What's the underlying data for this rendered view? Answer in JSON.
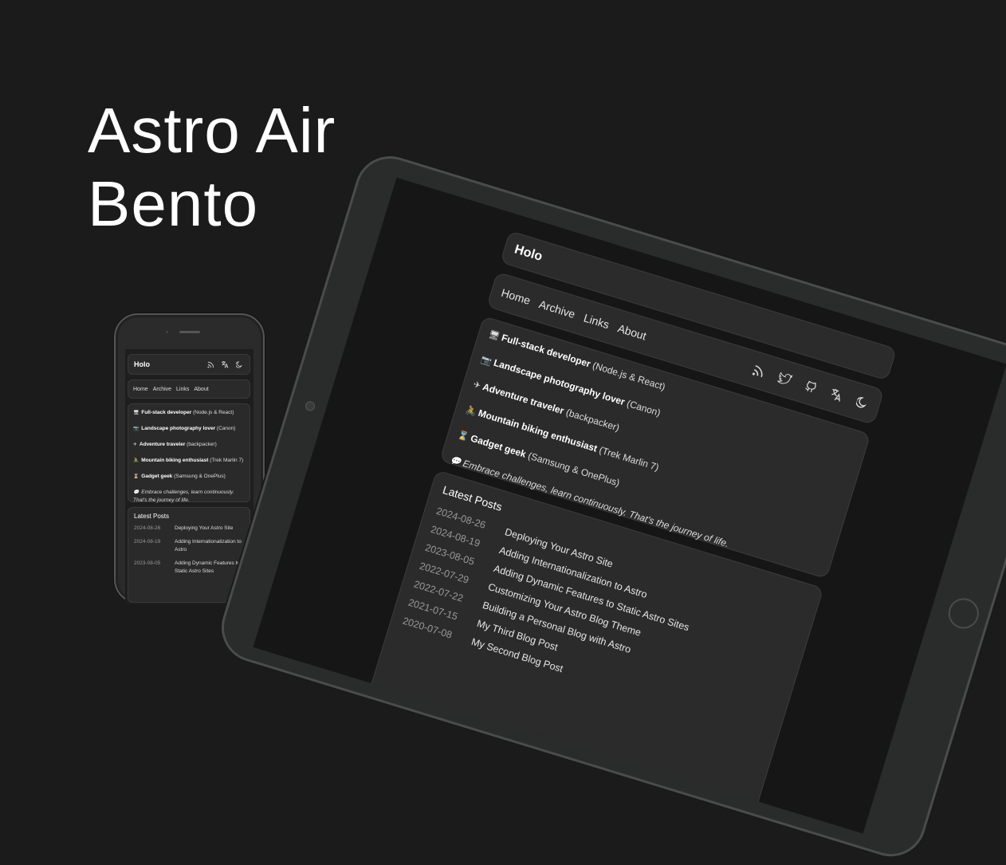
{
  "hero": {
    "line1": "Astro Air",
    "line2": "Bento"
  },
  "site": {
    "logo": "Holo",
    "nav": [
      "Home",
      "Archive",
      "Links",
      "About"
    ],
    "intro": [
      {
        "emoji": "🖥",
        "bold": "Full-stack developer",
        "rest": " (Node.js & React)"
      },
      {
        "emoji": "📷",
        "bold": "Landscape photography lover",
        "rest": " (Canon)"
      },
      {
        "emoji": "✈",
        "bold": "Adventure traveler",
        "rest": " (backpacker)"
      },
      {
        "emoji": "🚴",
        "bold": "Mountain biking enthusiast",
        "rest": " (Trek Marlin 7)"
      },
      {
        "emoji": "⌛",
        "bold": "Gadget geek",
        "rest": " (Samsung & OnePlus)"
      }
    ],
    "quote_emoji": "💬",
    "quote": "Embrace challenges, learn continuously. That's the journey of life.",
    "latest_posts_title": "Latest Posts",
    "posts": [
      {
        "date": "2024-08-26",
        "title": "Deploying Your Astro Site"
      },
      {
        "date": "2024-08-19",
        "title": "Adding Internationalization to Astro"
      },
      {
        "date": "2023-08-05",
        "title": "Adding Dynamic Features to Static Astro Sites"
      },
      {
        "date": "2022-07-29",
        "title": "Customizing Your Astro Blog Theme"
      },
      {
        "date": "2022-07-22",
        "title": "Building a Personal Blog with Astro"
      },
      {
        "date": "2021-07-15",
        "title": "My Third Blog Post"
      },
      {
        "date": "2020-07-08",
        "title": "My Second Blog Post"
      }
    ],
    "icons": [
      "rss-icon",
      "twitter-icon",
      "github-icon",
      "translate-icon",
      "moon-icon"
    ]
  }
}
